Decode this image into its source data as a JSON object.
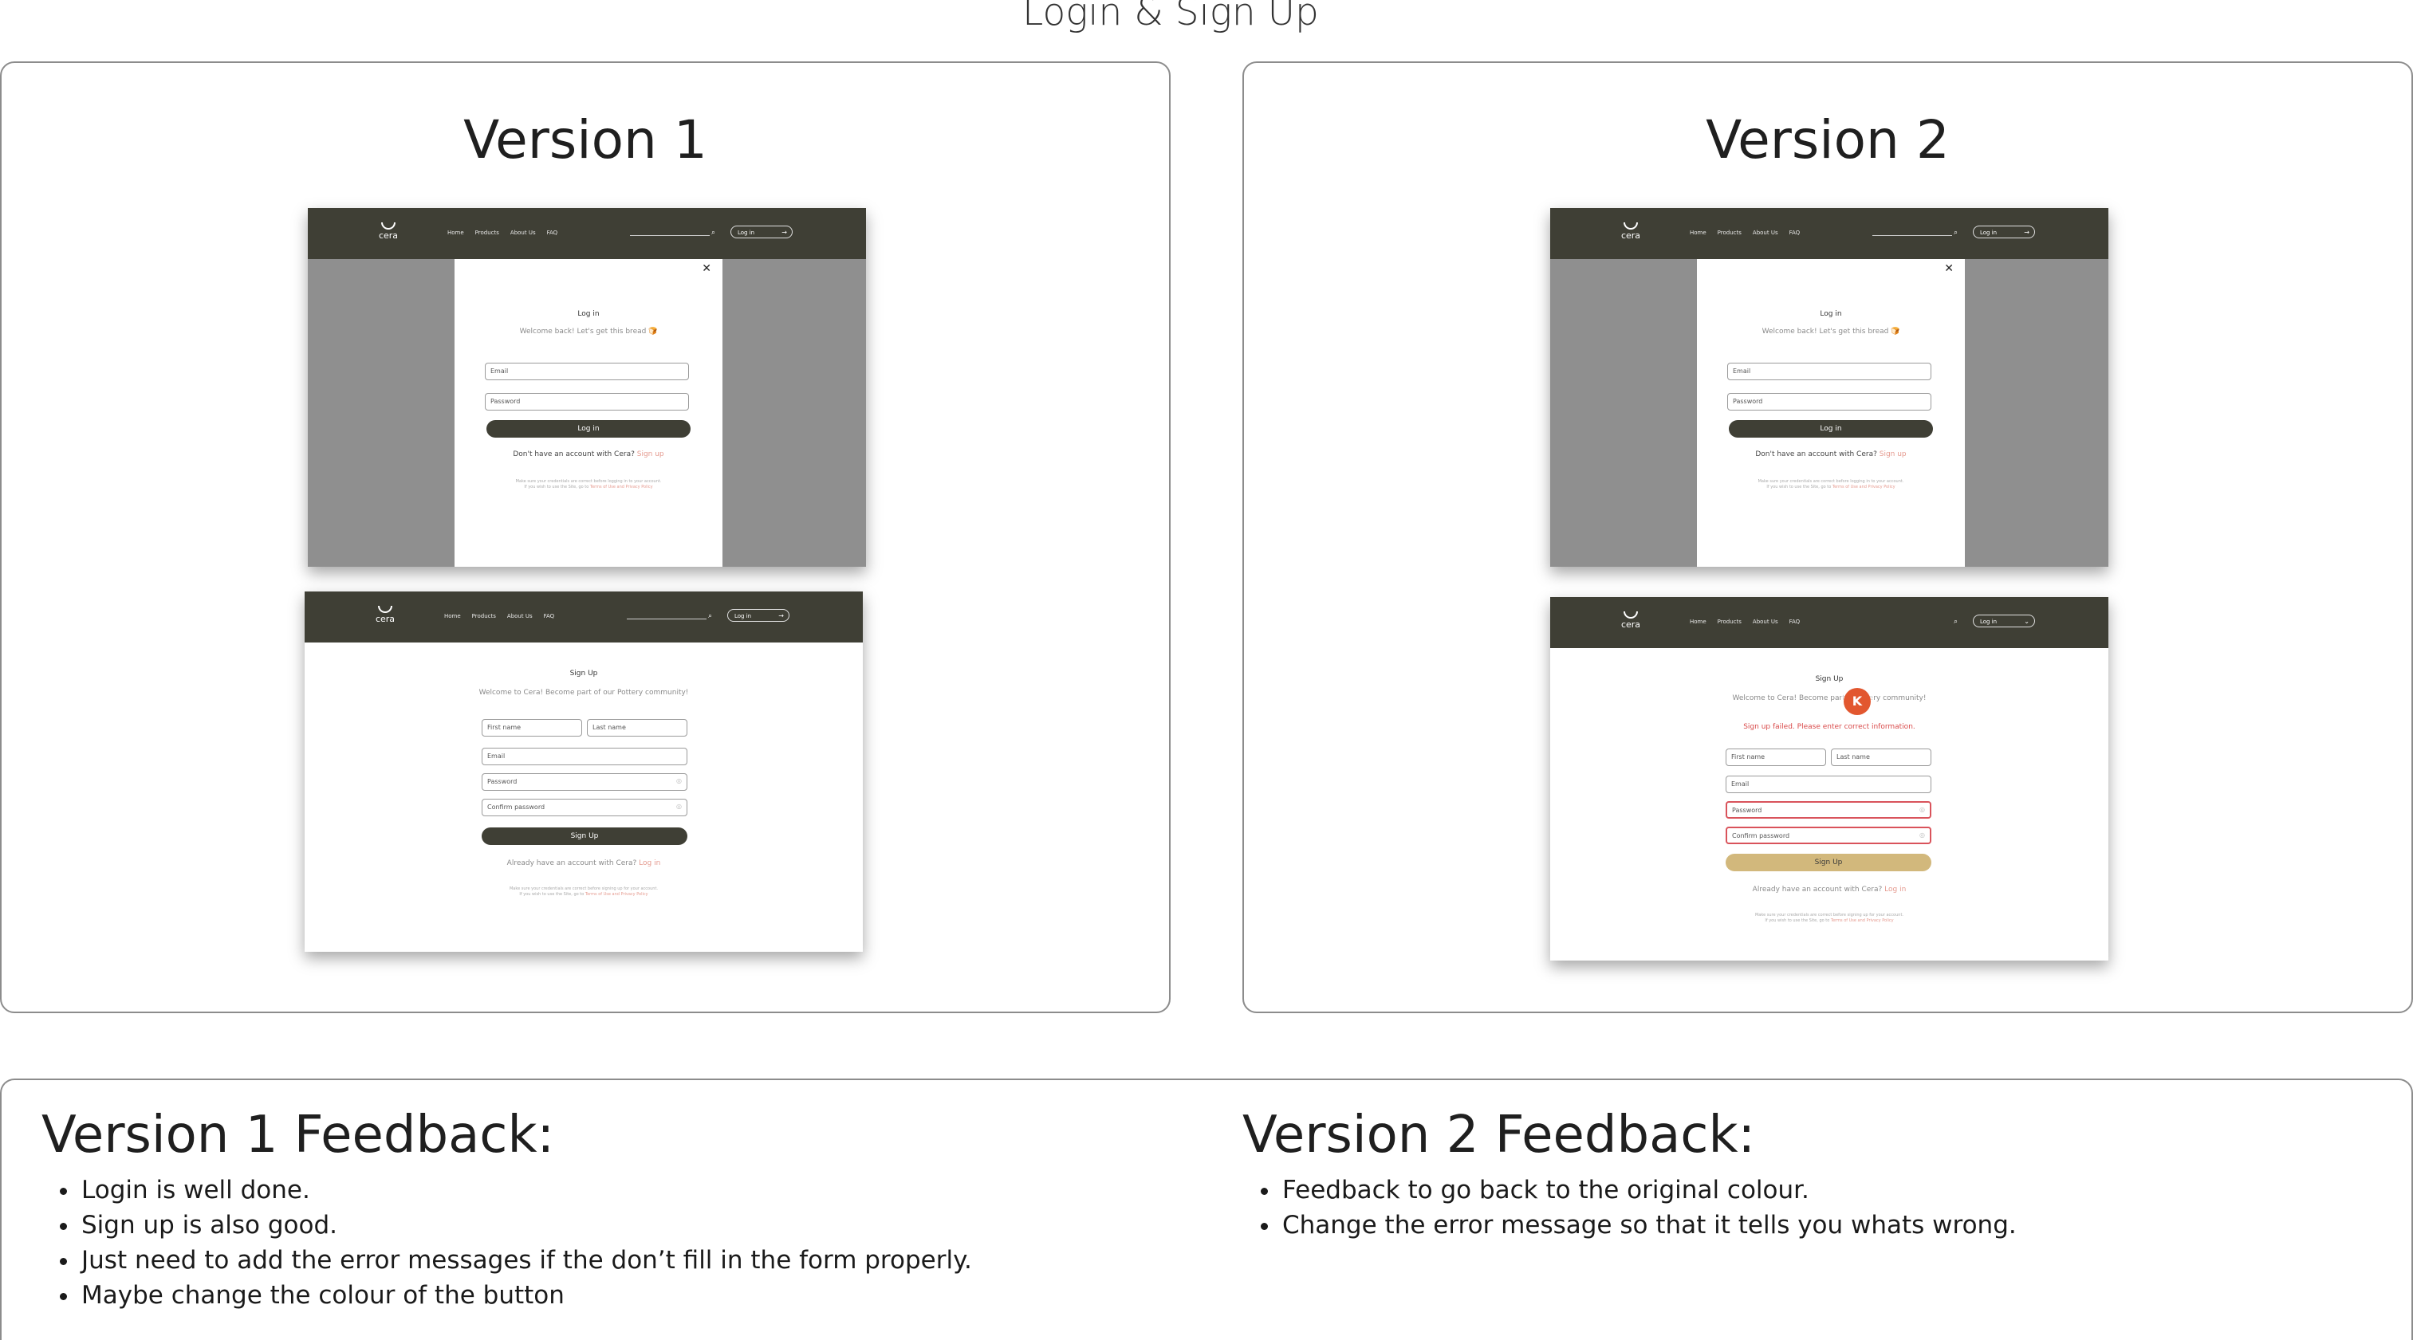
{
  "page_title": "Login & Sign Up",
  "versions": [
    {
      "title": "Version 1",
      "login": {
        "nav": {
          "logo": "cera",
          "links": [
            "Home",
            "Products",
            "About Us",
            "FAQ"
          ],
          "login_button": "Log in"
        },
        "title": "Log in",
        "subtitle": "Welcome back! Let's get this bread 🍞",
        "email_placeholder": "Email",
        "password_placeholder": "Password",
        "submit": "Log in",
        "switch_text": "Don't have an account with Cera?",
        "switch_link": "Sign up",
        "fine_print_1": "Make sure your credentials are correct before logging in to your account.",
        "fine_print_2": "If you wish to use the Site, go to",
        "fine_print_link": "Terms of Use and Privacy Policy"
      },
      "signup": {
        "nav": {
          "logo": "cera",
          "links": [
            "Home",
            "Products",
            "About Us",
            "FAQ"
          ],
          "login_button": "Log in"
        },
        "title": "Sign Up",
        "subtitle": "Welcome to Cera! Become part of our Pottery community!",
        "first_name": "First name",
        "last_name": "Last name",
        "email": "Email",
        "password": "Password",
        "confirm_password": "Confirm password",
        "submit": "Sign Up",
        "switch_text": "Already have an account with Cera?",
        "switch_link": "Log in",
        "fine_print_1": "Make sure your credentials are correct before signing up for your account.",
        "fine_print_2": "If you wish to use the Site, go to",
        "fine_print_link": "Terms of Use and Privacy Policy"
      }
    },
    {
      "title": "Version 2",
      "login": {
        "nav": {
          "logo": "cera",
          "links": [
            "Home",
            "Products",
            "About Us",
            "FAQ"
          ],
          "login_button": "Log in"
        },
        "title": "Log in",
        "subtitle": "Welcome back! Let's get this bread 🍞",
        "email_placeholder": "Email",
        "password_placeholder": "Password",
        "submit": "Log in",
        "switch_text": "Don't have an account with Cera?",
        "switch_link": "Sign up",
        "fine_print_1": "Make sure your credentials are correct before logging in to your account.",
        "fine_print_2": "If you wish to use the Site, go to",
        "fine_print_link": "Terms of Use and Privacy Policy"
      },
      "signup": {
        "nav": {
          "logo": "cera",
          "links": [
            "Home",
            "Products",
            "About Us",
            "FAQ"
          ],
          "login_button": "Log in"
        },
        "title": "Sign Up",
        "subtitle_left": "Welcome to Cera! Become part",
        "subtitle_right": "ttery community!",
        "cursor_letter": "K",
        "error": "Sign up failed. Please enter correct information.",
        "first_name": "First name",
        "last_name": "Last name",
        "email": "Email",
        "password": "Password",
        "confirm_password": "Confirm password",
        "submit": "Sign Up",
        "switch_text": "Already have an account with Cera?",
        "switch_link": "Log in",
        "fine_print_1": "Make sure your credentials are correct before signing up for your account.",
        "fine_print_2": "If you wish to use the Site, go to",
        "fine_print_link": "Terms of Use and Privacy Policy"
      }
    }
  ],
  "feedback": [
    {
      "title": "Version 1 Feedback:",
      "items": [
        "Login is well done.",
        "Sign up is also good.",
        "Just need to add the error messages if the don’t fill in the form properly.",
        "Maybe change the colour of the button"
      ]
    },
    {
      "title": "Version 2 Feedback:",
      "items": [
        "Feedback to go back to the original colour.",
        "Change the error message so that it tells you whats wrong."
      ]
    }
  ],
  "colors": {
    "nav_bg": "#3f3f35",
    "primary_button": "#3f3f35",
    "v2_button": "#d2b87c",
    "error": "#d94a4a",
    "link": "#e59a8f"
  }
}
